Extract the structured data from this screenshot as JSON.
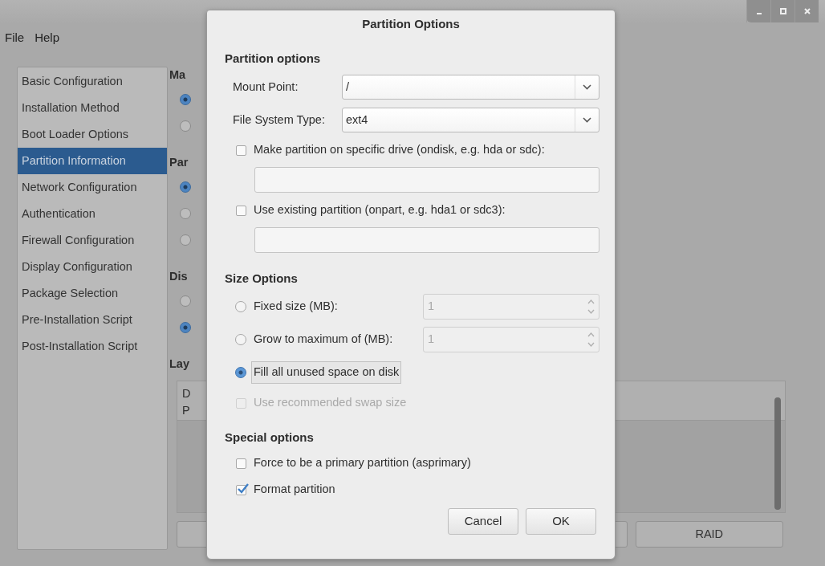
{
  "window": {
    "menu": [
      "File",
      "Help"
    ]
  },
  "sidebar": {
    "items": [
      {
        "label": "Basic Configuration",
        "selected": false
      },
      {
        "label": "Installation Method",
        "selected": false
      },
      {
        "label": "Boot Loader Options",
        "selected": false
      },
      {
        "label": "Partition Information",
        "selected": true
      },
      {
        "label": "Network Configuration",
        "selected": false
      },
      {
        "label": "Authentication",
        "selected": false
      },
      {
        "label": "Firewall Configuration",
        "selected": false
      },
      {
        "label": "Display Configuration",
        "selected": false
      },
      {
        "label": "Package Selection",
        "selected": false
      },
      {
        "label": "Pre-Installation Script",
        "selected": false
      },
      {
        "label": "Post-Installation Script",
        "selected": false
      }
    ]
  },
  "main": {
    "sections": [
      {
        "heading": "Ma",
        "options": [
          {
            "selected": true
          },
          {
            "selected": false
          }
        ]
      },
      {
        "heading": "Par",
        "options": [
          {
            "selected": true
          },
          {
            "selected": false
          },
          {
            "selected": false
          }
        ]
      },
      {
        "heading": "Dis",
        "options": [
          {
            "selected": false
          },
          {
            "selected": true
          }
        ]
      }
    ],
    "layout": {
      "heading": "Lay",
      "rows": [
        "D",
        "P"
      ],
      "buttons": [
        "RAID"
      ]
    }
  },
  "dialog": {
    "title": "Partition Options",
    "items": [
      {
        "kind": "heading",
        "text": "Partition options"
      },
      {
        "kind": "combo",
        "label": "Mount Point:",
        "value": "/"
      },
      {
        "kind": "combo",
        "label": "File System Type:",
        "value": "ext4"
      },
      {
        "kind": "checkbox",
        "label": "Make partition on specific drive (ondisk, e.g. hda or sdc):",
        "checked": false,
        "disabled": false
      },
      {
        "kind": "entry"
      },
      {
        "kind": "checkbox",
        "label": "Use existing partition (onpart, e.g. hda1 or sdc3):",
        "checked": false,
        "disabled": false
      },
      {
        "kind": "entry"
      },
      {
        "kind": "heading",
        "text": "Size Options"
      },
      {
        "kind": "radio",
        "label": "Fixed size (MB):",
        "selected": false,
        "focused": false,
        "spin": "1"
      },
      {
        "kind": "radio",
        "label": "Grow to maximum of (MB):",
        "selected": false,
        "focused": false,
        "spin": "1"
      },
      {
        "kind": "radio",
        "label": "Fill all unused space on disk",
        "selected": true,
        "focused": true
      },
      {
        "kind": "checkbox",
        "label": "Use recommended swap size",
        "checked": false,
        "disabled": true
      },
      {
        "kind": "heading",
        "text": "Special options"
      },
      {
        "kind": "checkbox",
        "label": "Force to be a primary partition (asprimary)",
        "checked": false,
        "disabled": false
      },
      {
        "kind": "checkbox",
        "label": "Format partition",
        "checked": true,
        "disabled": false
      }
    ],
    "buttons": [
      "Cancel",
      "OK"
    ]
  }
}
